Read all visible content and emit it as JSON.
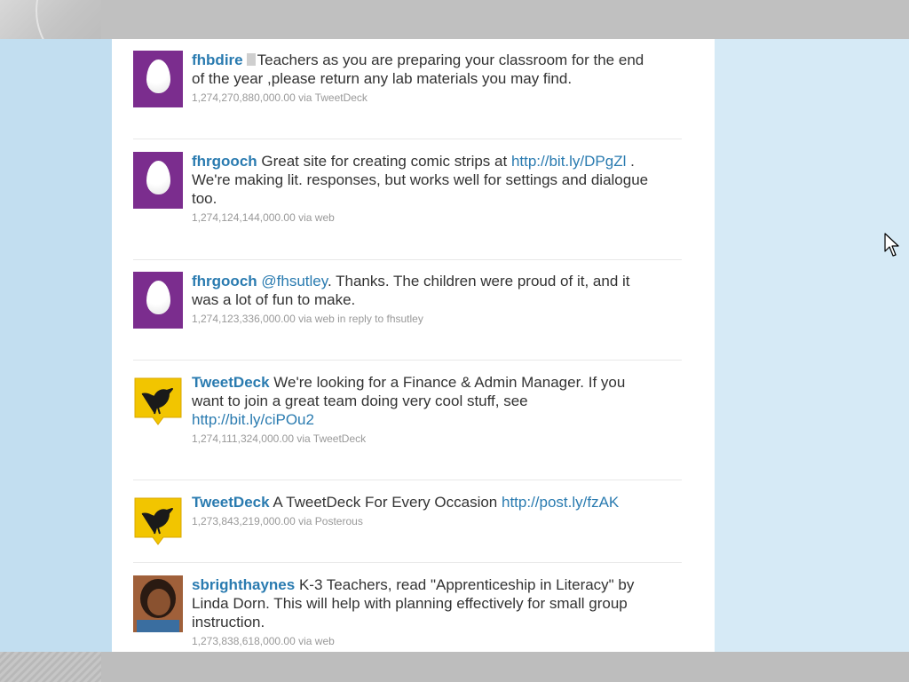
{
  "tweets": [
    {
      "user": "fhbdire",
      "text": "Teachers as you are preparing your classroom for the end of the year ,please return any lab materials you may find.",
      "meta": "1,274,270,880,000.00 via TweetDeck",
      "avatar": "egg-avatar-purple"
    },
    {
      "user": "fhrgooch",
      "text_before": "Great site for creating comic strips at ",
      "link": "http://bit.ly/DPgZl",
      "text_after": " . We're making lit. responses, but works well for settings and dialogue too.",
      "meta": "1,274,124,144,000.00 via web",
      "avatar": "egg-avatar-purple"
    },
    {
      "user": "fhrgooch",
      "mention": "@fhsutley",
      "text_after": ". Thanks. The children were proud of it, and it was a lot of fun to make.",
      "meta": "1,274,123,336,000.00 via web in reply to fhsutley",
      "avatar": "egg-avatar-purple"
    },
    {
      "user": "TweetDeck",
      "text_before": "We're looking for a Finance & Admin Manager. If you want to join a great team doing very cool stuff, see ",
      "link": "http://bit.ly/ciPOu2",
      "meta": "1,274,111,324,000.00 via TweetDeck",
      "avatar": "tweetdeck-bird-avatar"
    },
    {
      "user": "TweetDeck",
      "text_before": "A TweetDeck For Every Occasion ",
      "link": "http://post.ly/fzAK",
      "meta": "1,273,843,219,000.00 via Posterous",
      "avatar": "tweetdeck-bird-avatar"
    },
    {
      "user": "sbrighthaynes",
      "text": "K-3 Teachers, read \"Apprenticeship in Literacy\" by Linda Dorn. This will help with planning effectively for small group instruction.",
      "meta": "1,273,838,618,000.00 via web",
      "avatar": "user-photo-avatar"
    }
  ],
  "colors": {
    "link": "#2a7bb0",
    "egg_bg": "#7b2d8e",
    "tweetdeck_yellow": "#f2c500",
    "left_panel": "#c2def0",
    "right_panel": "#d6eaf6"
  }
}
